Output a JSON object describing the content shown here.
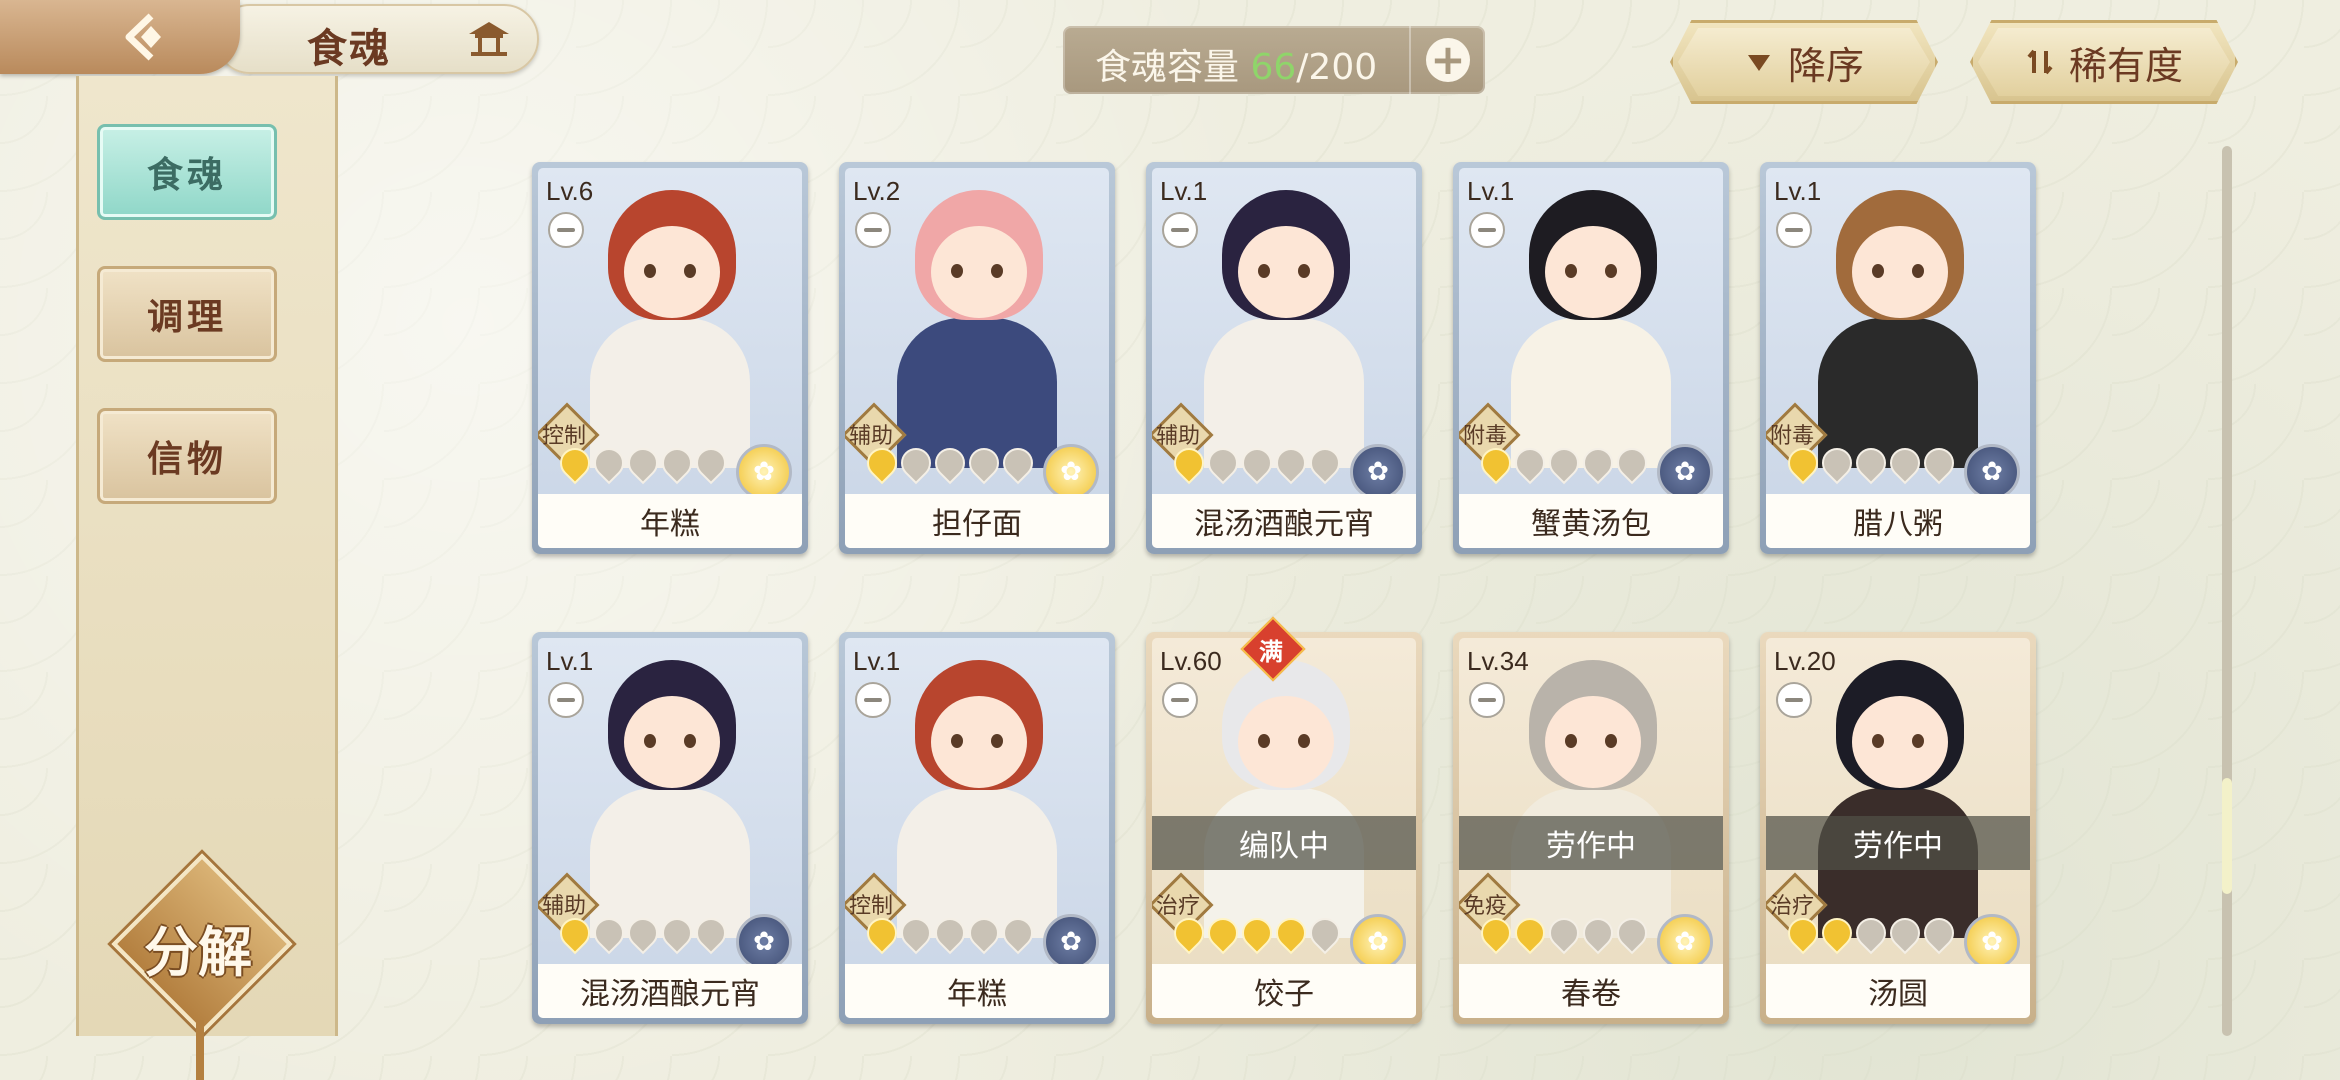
{
  "header": {
    "title": "食魂",
    "capacity_label": "食魂容量",
    "capacity_current": "66",
    "capacity_max": "/200",
    "sort_order_label": "降序",
    "sort_key_label": "稀有度"
  },
  "sidebar": {
    "items": [
      {
        "label": "食魂"
      },
      {
        "label": "调理"
      },
      {
        "label": "信物"
      }
    ],
    "decompose_label": "分解"
  },
  "cards": [
    {
      "level": "Lv.6",
      "role": "控制",
      "name": "年糕",
      "stars": 1,
      "rarity": "gold"
    },
    {
      "level": "Lv.2",
      "role": "辅助",
      "name": "担仔面",
      "stars": 1,
      "rarity": "gold"
    },
    {
      "level": "Lv.1",
      "role": "辅助",
      "name": "混汤酒酿元宵",
      "stars": 1,
      "rarity": "navy"
    },
    {
      "level": "Lv.1",
      "role": "附毒",
      "name": "蟹黄汤包",
      "stars": 1,
      "rarity": "navy"
    },
    {
      "level": "Lv.1",
      "role": "附毒",
      "name": "腊八粥",
      "stars": 1,
      "rarity": "navy"
    },
    {
      "level": "Lv.1",
      "role": "辅助",
      "name": "混汤酒酿元宵",
      "stars": 1,
      "rarity": "navy"
    },
    {
      "level": "Lv.1",
      "role": "控制",
      "name": "年糕",
      "stars": 1,
      "rarity": "navy"
    },
    {
      "level": "Lv.60",
      "role": "治疗",
      "name": "饺子",
      "stars": 4,
      "rarity": "gold",
      "status": "编队中",
      "full_badge": "满"
    },
    {
      "level": "Lv.34",
      "role": "免疫",
      "name": "春卷",
      "stars": 2,
      "rarity": "gold",
      "status": "劳作中"
    },
    {
      "level": "Lv.20",
      "role": "治疗",
      "name": "汤圆",
      "stars": 2,
      "rarity": "gold",
      "status": "劳作中"
    }
  ],
  "colors": {
    "accent_active": "#8fd7c8",
    "capacity_current": "#8fd56a",
    "rarity_gold": "#f1c232",
    "rarity_navy": "#3f4d73"
  }
}
